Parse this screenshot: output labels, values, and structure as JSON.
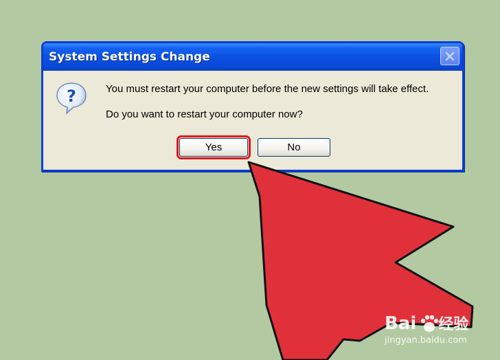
{
  "dialog": {
    "title": "System Settings Change",
    "message_line1": "You must restart your computer before the new settings will take effect.",
    "message_line2": "Do you want to restart your computer now?",
    "icon": "question-icon",
    "buttons": {
      "yes_label": "Yes",
      "no_label": "No",
      "close_icon": "close-icon"
    }
  },
  "overlay": {
    "arrow_color": "#e0303a",
    "highlight_color": "#e2141c",
    "highlighted_button": "Yes"
  },
  "watermark": {
    "logo_text": "Bai",
    "logo_suffix": "经验",
    "url": "jingyan.baidu.com"
  },
  "colors": {
    "background": "#b2c9a2",
    "titlebar": "#0a4fe0",
    "dialog_face": "#ece9d8"
  }
}
